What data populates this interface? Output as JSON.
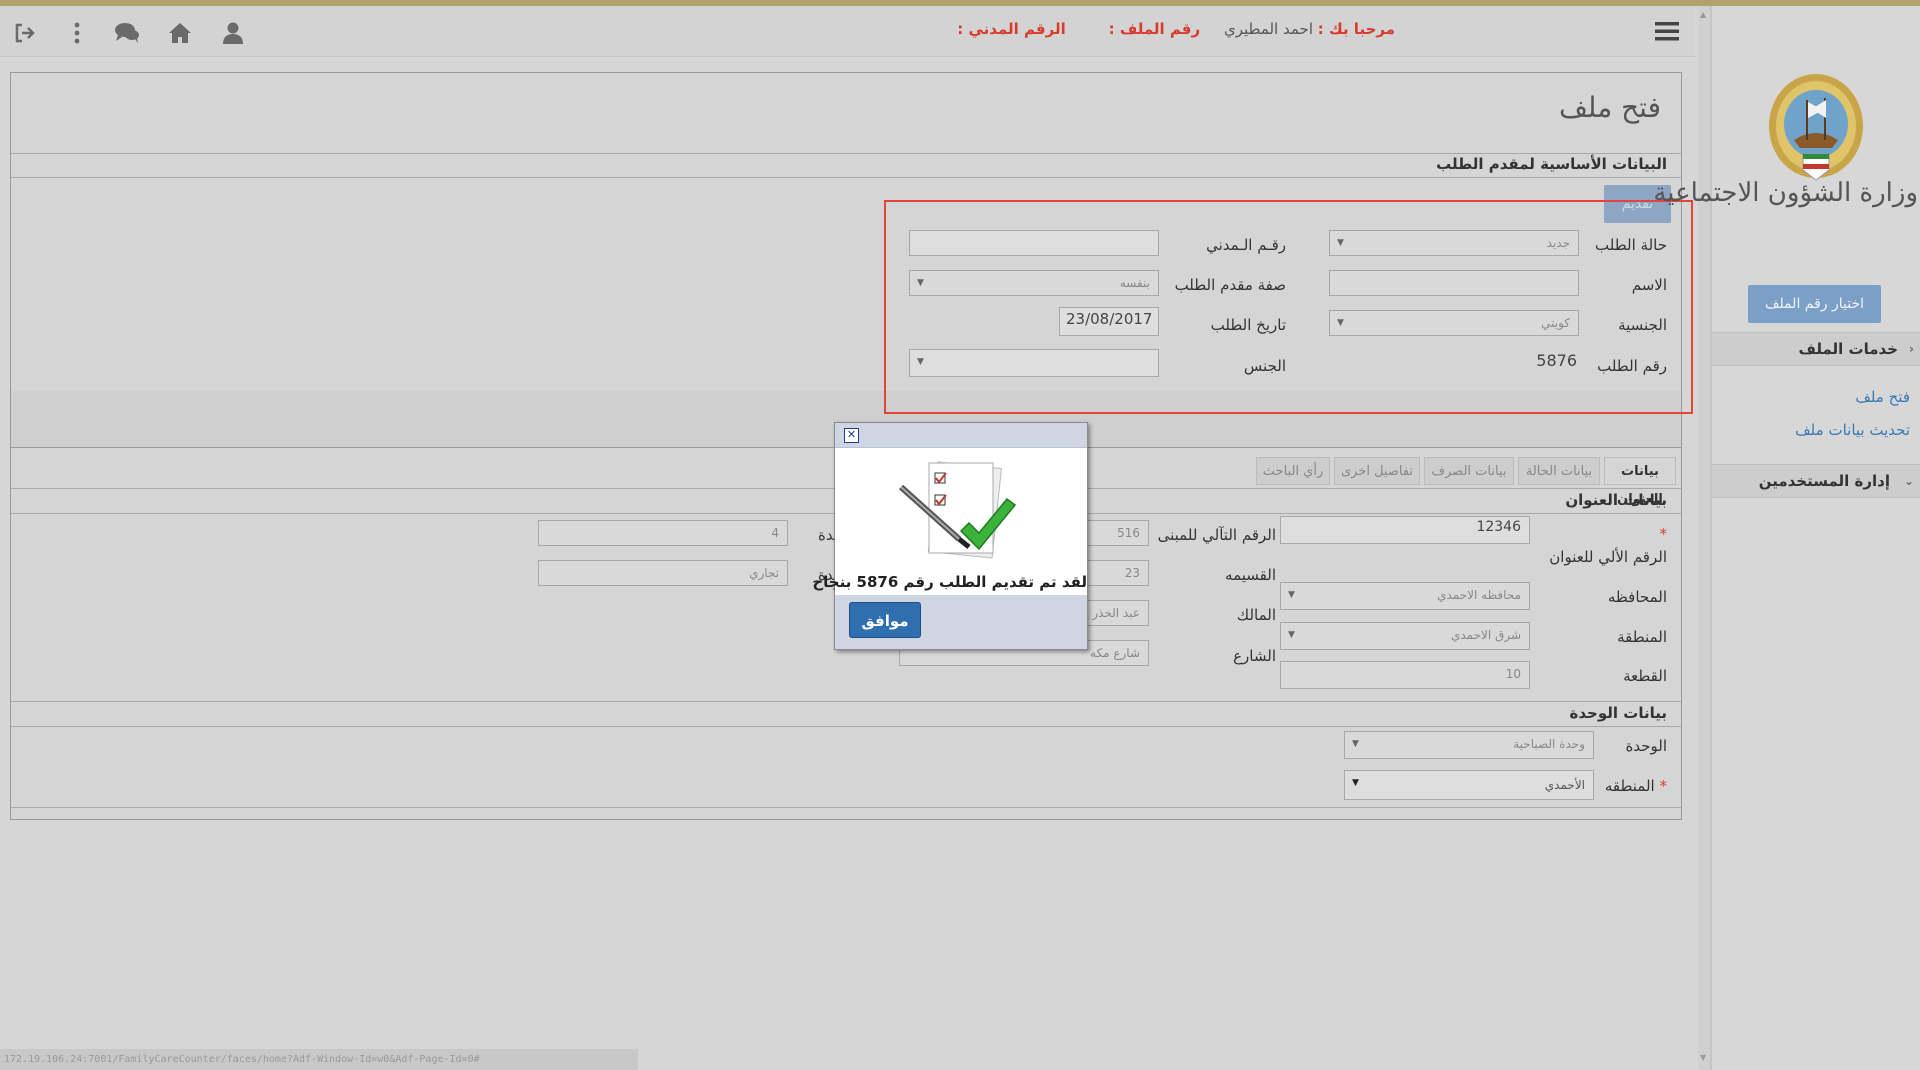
{
  "topbar": {
    "welcome_label": "مرحبا بك :",
    "user_name": "احمد المطيري",
    "file_no_label": "رقم الملف :",
    "civil_id_label": "الرقم المدني :"
  },
  "page": {
    "title": "فتح ملف",
    "basic_section": "البيانات الأساسية لمقدم الطلب",
    "submit_label": "تقديم"
  },
  "basic_form": {
    "status_label": "حالة الطلب",
    "status_value": "جديد",
    "name_label": "الاسم",
    "nationality_label": "الجنسية",
    "nationality_value": "كويتي",
    "request_no_label": "رقم الطلب",
    "request_no_value": "5876",
    "civil_id_label": "رقـم الـمدني",
    "applicant_type_label": "صفة مقدم الطلب",
    "applicant_type_value": "بنفسه",
    "request_date_label": "تاريخ الطلب",
    "request_date_value": "23/08/2017",
    "gender_label": "الجنس"
  },
  "tabs": [
    "بيانات العنوان",
    "بيانات الحالة",
    "بيانات الصرف",
    "تفاصيل اخرى",
    "رأي الباحث"
  ],
  "address": {
    "section": "بيانات العنوان",
    "auto_no_label": "الرقم الألي للعنوان",
    "auto_no_value": "12346",
    "governorate_label": "المحافظه",
    "governorate_value": "محافظه الاحمدي",
    "area_label": "المنطقة",
    "area_value": "شرق الاحمدي",
    "block_label": "القطعة",
    "block_value": "10",
    "building_auto_label": "الرقم التآلي للمبنى",
    "building_auto_value": "516",
    "plot_label": "القسيمه",
    "plot_value": "23",
    "owner_label": "المالك",
    "owner_value": "عبد الخذر ع",
    "street_label": "الشارع",
    "street_value": "شارع مكه",
    "unit_label": "حدة",
    "unit_value": "4",
    "unit_type_label": "حدة",
    "unit_type_value": "تجاري"
  },
  "unit": {
    "section": "بيانات الوحدة",
    "unit_label": "الوحدة",
    "unit_value": "وحدة الصباحية",
    "region_label": "المنطقه",
    "region_value": "الأحمدي"
  },
  "sidebar": {
    "ministry": "وزارة الشؤون الاجتماعية",
    "choose_file": "اختيار رقم الملف",
    "file_services": "خدمات الملف",
    "items": [
      "فتح ملف",
      "تحديث بيانات ملف"
    ],
    "users_admin": "إدارة المستخدمين"
  },
  "dialog": {
    "message": "لقد تم تقديم الطلب رقم  5876 بنجاح",
    "ok": "موافق",
    "close": "✕"
  },
  "status_url": "172.19.106.24:7001/FamilyCareCounter/faces/home?Adf-Window-Id=w0&Adf-Page-Id=0#",
  "colors": {
    "accent": "#d93a2b",
    "brand_button": "#7b9fc7",
    "dialog_button": "#2f6fb0"
  }
}
